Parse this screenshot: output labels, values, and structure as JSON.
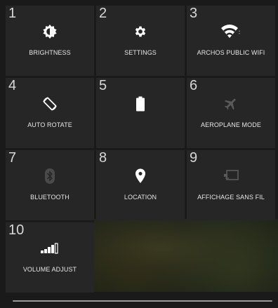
{
  "quick_settings": {
    "tiles": [
      {
        "number": "1",
        "label": "BRIGHTNESS",
        "icon": "brightness-icon",
        "active": true
      },
      {
        "number": "2",
        "label": "SETTINGS",
        "icon": "gear-icon",
        "active": true
      },
      {
        "number": "3",
        "label": "ARCHOS PUBLIC WIFI",
        "icon": "wifi-icon",
        "active": true
      },
      {
        "number": "4",
        "label": "AUTO ROTATE",
        "icon": "auto-rotate-icon",
        "active": true
      },
      {
        "number": "5",
        "label": "",
        "icon": "battery-icon",
        "active": true
      },
      {
        "number": "6",
        "label": "AEROPLANE MODE",
        "icon": "airplane-icon",
        "active": false
      },
      {
        "number": "7",
        "label": "BLUETOOTH",
        "icon": "bluetooth-icon",
        "active": false
      },
      {
        "number": "8",
        "label": "LOCATION",
        "icon": "location-pin-icon",
        "active": true
      },
      {
        "number": "9",
        "label": "AFFICHAGE SANS FIL",
        "icon": "cast-screen-icon",
        "active": false
      },
      {
        "number": "10",
        "label": "VOLUME ADJUST",
        "icon": "volume-bars-icon",
        "active": true
      }
    ]
  },
  "colors": {
    "tile_bg": "#262626",
    "active_icon": "#ffffff",
    "inactive_icon": "#5a5a5a"
  }
}
